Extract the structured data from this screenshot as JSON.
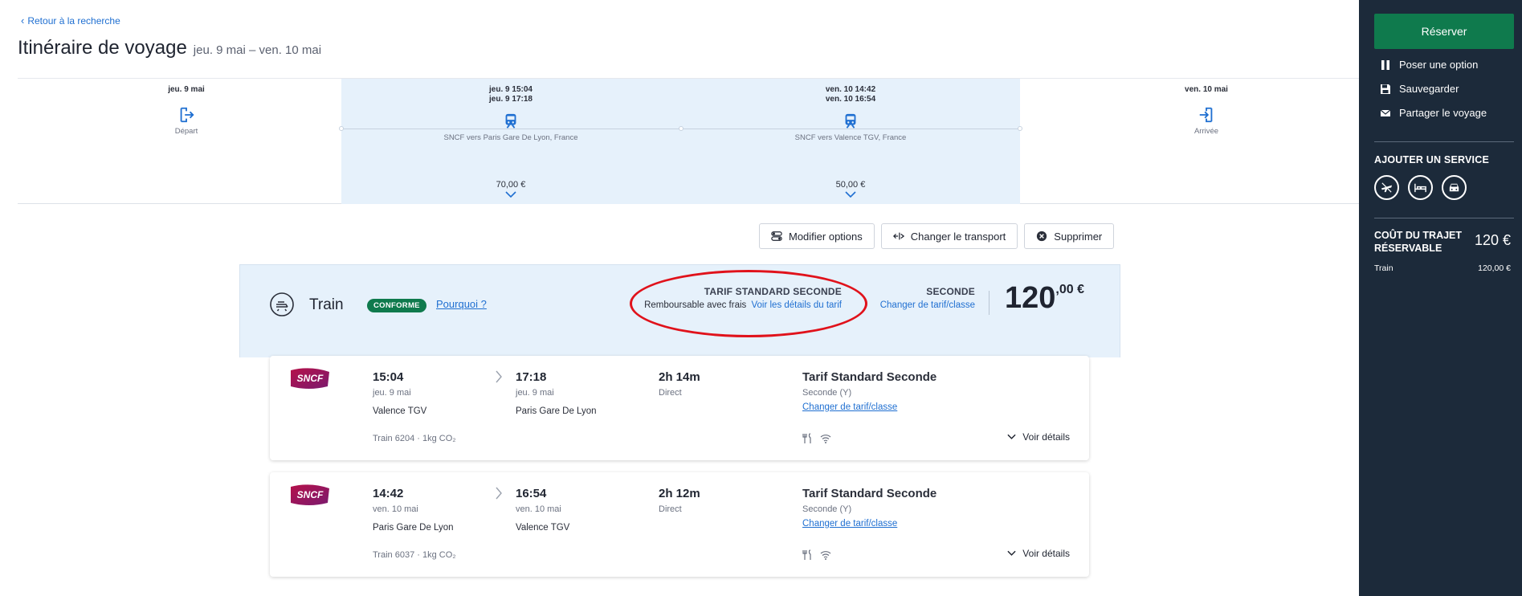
{
  "header": {
    "back_label": "Retour à la recherche",
    "title": "Itinéraire de voyage",
    "dates": "jeu. 9 mai – ven. 10 mai"
  },
  "timeline": {
    "departure": {
      "date": "jeu. 9 mai",
      "label": "Départ",
      "icon": "departure-icon"
    },
    "leg1": {
      "line1": "jeu. 9   15:04",
      "line2": "jeu. 9   17:18",
      "label": "SNCF vers Paris Gare De Lyon, France",
      "price": "70,00 €",
      "icon": "train-icon"
    },
    "leg2": {
      "line1": "ven. 10   14:42",
      "line2": "ven. 10   16:54",
      "label": "SNCF vers Valence TGV, France",
      "price": "50,00 €",
      "icon": "train-icon"
    },
    "arrival": {
      "date": "ven. 10 mai",
      "label": "Arrivée",
      "icon": "arrival-icon"
    }
  },
  "actions": {
    "modify": "Modifier options",
    "change_transport": "Changer le transport",
    "delete": "Supprimer"
  },
  "summary": {
    "title": "Train",
    "badge": "CONFORME",
    "why": "Pourquoi ?",
    "fare_name": "TARIF STANDARD SECONDE",
    "fare_sub": "Remboursable avec frais",
    "fare_link": "Voir les détails du tarif",
    "class_name": "SECONDE",
    "class_link": "Changer de tarif/classe",
    "price_int": "120",
    "price_dec": ",00 €"
  },
  "segments": [
    {
      "dep_time": "15:04",
      "dep_date": "jeu. 9 mai",
      "dep_station": "Valence TGV",
      "arr_time": "17:18",
      "arr_date": "jeu. 9 mai",
      "arr_station": "Paris Gare De Lyon",
      "duration": "2h 14m",
      "stops": "Direct",
      "train": "Train 6204 · 1kg CO₂",
      "fare_name": "Tarif Standard Seconde",
      "fare_class": "Seconde (Y)",
      "fare_link": "Changer de tarif/classe",
      "details": "Voir détails"
    },
    {
      "dep_time": "14:42",
      "dep_date": "ven. 10 mai",
      "dep_station": "Paris Gare De Lyon",
      "arr_time": "16:54",
      "arr_date": "ven. 10 mai",
      "arr_station": "Valence TGV",
      "duration": "2h 12m",
      "stops": "Direct",
      "train": "Train 6037 · 1kg CO₂",
      "fare_name": "Tarif Standard Seconde",
      "fare_class": "Seconde (Y)",
      "fare_link": "Changer de tarif/classe",
      "details": "Voir détails"
    }
  ],
  "sidebar": {
    "reserve": "Réserver",
    "hold": "Poser une option",
    "save": "Sauvegarder",
    "share": "Partager le voyage",
    "services_heading": "AJOUTER UN SERVICE",
    "cost_title": "COÛT DU TRAJET RÉSERVABLE",
    "cost_total": "120 €",
    "cost_item_label": "Train",
    "cost_item_value": "120,00 €"
  },
  "colors": {
    "accent_green": "#0f7a4d",
    "link_blue": "#1f6fd1",
    "sidebar_bg": "#1c2a3a",
    "highlight_bg": "#e6f1fb",
    "annotation_red": "#e0121b"
  }
}
